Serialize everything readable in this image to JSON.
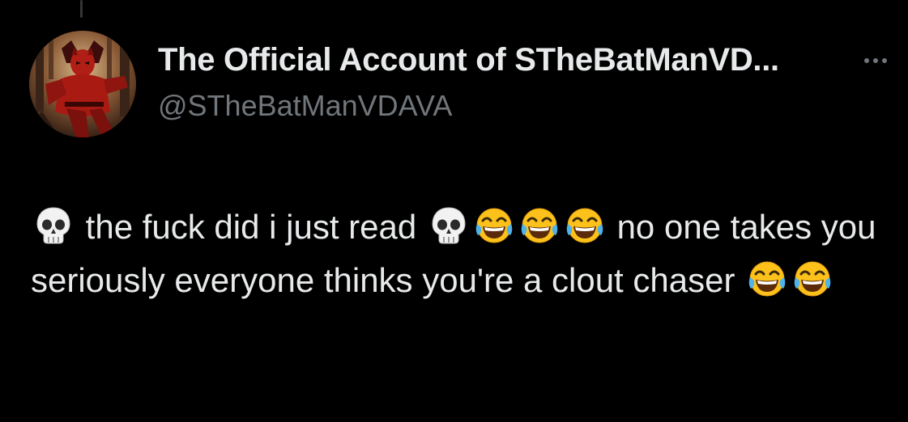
{
  "author": {
    "display_name": "The Official Account of STheBatManVD...",
    "handle": "@STheBatManVDAVA",
    "avatar_icon": "daredevil-avatar"
  },
  "more_menu_icon": "more-options-icon",
  "tweet": {
    "segments": [
      {
        "type": "emoji",
        "name": "skull-emoji"
      },
      {
        "type": "text",
        "value": " the fuck did i just read "
      },
      {
        "type": "emoji",
        "name": "skull-emoji"
      },
      {
        "type": "emoji",
        "name": "tears-of-joy-emoji"
      },
      {
        "type": "emoji",
        "name": "tears-of-joy-emoji"
      },
      {
        "type": "emoji",
        "name": "tears-of-joy-emoji"
      },
      {
        "type": "text",
        "value": " no one takes you seriously everyone thinks you're a clout chaser "
      },
      {
        "type": "emoji",
        "name": "tears-of-joy-emoji"
      },
      {
        "type": "emoji",
        "name": "tears-of-joy-emoji"
      }
    ]
  },
  "colors": {
    "background": "#000000",
    "primary_text": "#e7e9ea",
    "secondary_text": "#71767b",
    "thread_line": "#333639"
  }
}
